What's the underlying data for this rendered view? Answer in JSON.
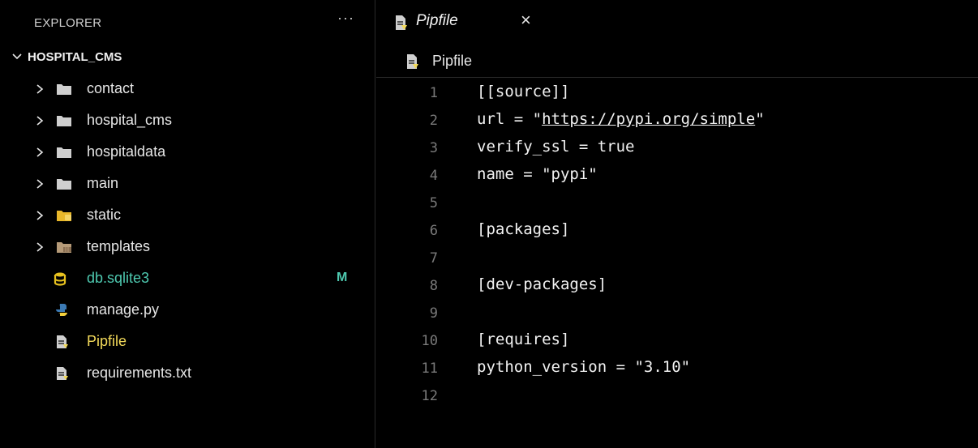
{
  "explorer": {
    "title": "EXPLORER",
    "more": "···",
    "workspace": "HOSPITAL_CMS",
    "items": [
      {
        "label": "contact",
        "type": "folder"
      },
      {
        "label": "hospital_cms",
        "type": "folder"
      },
      {
        "label": "hospitaldata",
        "type": "folder"
      },
      {
        "label": "main",
        "type": "folder"
      },
      {
        "label": "static",
        "type": "folder-static"
      },
      {
        "label": "templates",
        "type": "folder-templates"
      },
      {
        "label": "db.sqlite3",
        "type": "database",
        "badge": "M"
      },
      {
        "label": "manage.py",
        "type": "python"
      },
      {
        "label": "Pipfile",
        "type": "file"
      },
      {
        "label": "requirements.txt",
        "type": "file"
      }
    ]
  },
  "colors": {
    "modified": "#4ec9b0",
    "folder": "#cfcfcf",
    "static_folder": "#e8b72a",
    "templates_folder": "#b59a78",
    "database": "#e8c21f",
    "python_blue": "#3c7ab4",
    "python_yellow": "#f2cf3c",
    "pipfile": "#f2d95a"
  },
  "tab": {
    "label": "Pipfile",
    "close": "×"
  },
  "breadcrumb": {
    "label": "Pipfile"
  },
  "code": {
    "lines": [
      {
        "n": "1",
        "text": "[[source]]"
      },
      {
        "n": "2",
        "pre": "url = \"",
        "link": "https://pypi.org/simple",
        "post": "\""
      },
      {
        "n": "3",
        "text": "verify_ssl = true"
      },
      {
        "n": "4",
        "text": "name = \"pypi\""
      },
      {
        "n": "5",
        "text": ""
      },
      {
        "n": "6",
        "text": "[packages]"
      },
      {
        "n": "7",
        "text": ""
      },
      {
        "n": "8",
        "text": "[dev-packages]"
      },
      {
        "n": "9",
        "text": ""
      },
      {
        "n": "10",
        "text": "[requires]"
      },
      {
        "n": "11",
        "text": "python_version = \"3.10\""
      },
      {
        "n": "12",
        "text": ""
      }
    ]
  }
}
